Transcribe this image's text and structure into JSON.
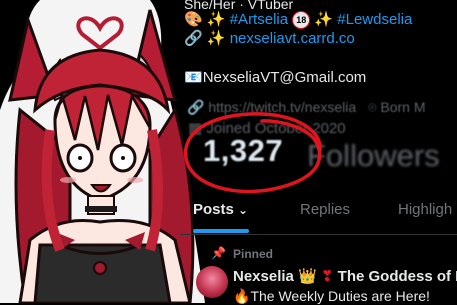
{
  "bio": {
    "line1_text": "She/Her · VTuber",
    "line2_prefix": "✨",
    "line2_hashtag1": "#Artselia",
    "line2_badge": "18",
    "line2_hashtag2": "#Lewdselia",
    "line3_link": "nexseliavt.carrd.co",
    "email": "NexseliaVT@Gmail.com"
  },
  "profile_meta": {
    "website": "https://twitch.tv/nexselia",
    "location_prefix": "Born M",
    "joined": "Joined October 2020"
  },
  "stats": {
    "followers_count": "1,327",
    "followers_label": "Followers"
  },
  "tabs": {
    "posts": "Posts",
    "replies": "Replies",
    "highlights": "Highligh"
  },
  "pinned_post": {
    "pinned_label": "Pinned",
    "author": "Nexselia",
    "title_suffix": "The Goddess of I",
    "body": "The Weekly Duties are Here!"
  },
  "colors": {
    "accent": "#1d9bf0",
    "annotation_circle": "#e0141e"
  }
}
